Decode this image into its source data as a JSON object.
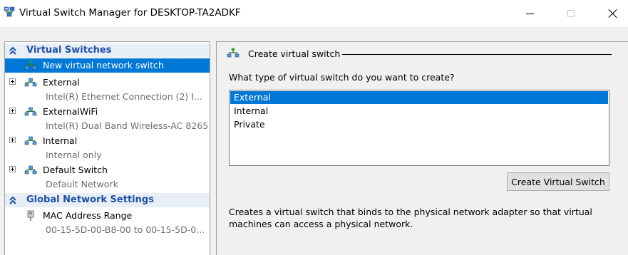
{
  "window": {
    "title": "Virtual Switch Manager for DESKTOP-TA2ADKF"
  },
  "sidebar": {
    "sections": [
      {
        "title": "Virtual Switches",
        "items": [
          {
            "label": "New virtual network switch",
            "selected": true
          },
          {
            "label": "External",
            "sub": "Intel(R) Ethernet Connection (2) I..."
          },
          {
            "label": "ExternalWiFi",
            "sub": "Intel(R) Dual Band Wireless-AC 8265"
          },
          {
            "label": "Internal",
            "sub": "Internal only"
          },
          {
            "label": "Default Switch",
            "sub": "Default Network"
          }
        ]
      },
      {
        "title": "Global Network Settings",
        "items": [
          {
            "label": "MAC Address Range",
            "sub": "00-15-5D-00-B8-00 to 00-15-5D-0..."
          }
        ]
      }
    ]
  },
  "main": {
    "group_title": "Create virtual switch",
    "question": "What type of virtual switch do you want to create?",
    "switch_types": [
      "External",
      "Internal",
      "Private"
    ],
    "selected_type": "External",
    "create_button": "Create Virtual Switch",
    "description": "Creates a virtual switch that binds to the physical network adapter so that virtual machines can access a physical network."
  },
  "colors": {
    "selection": "#0078d7",
    "section_header_text": "#1f4fa8",
    "section_header_bg": "#e8eef6"
  }
}
